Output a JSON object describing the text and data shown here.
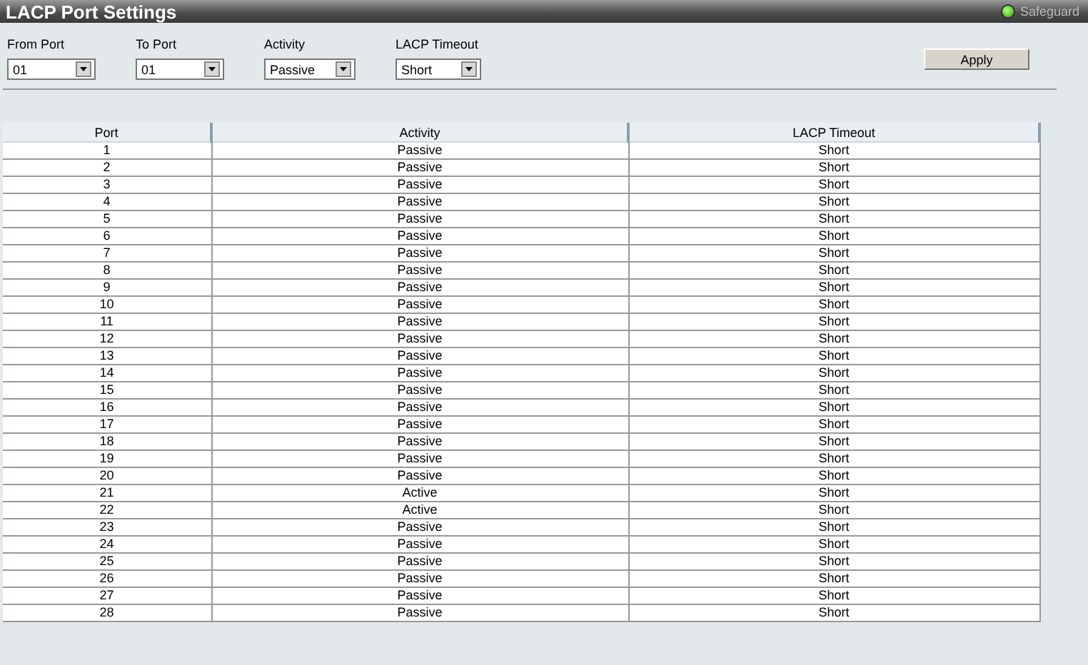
{
  "window": {
    "title": "LACP Port Settings",
    "status": {
      "label": "Safeguard",
      "on": true
    }
  },
  "form": {
    "fields": [
      {
        "label": "From Port",
        "value": "01"
      },
      {
        "label": "To Port",
        "value": "01"
      },
      {
        "label": "Activity",
        "value": "Passive"
      },
      {
        "label": "LACP Timeout",
        "value": "Short"
      }
    ],
    "apply": "Apply"
  },
  "table": {
    "columns": [
      "Port",
      "Activity",
      "LACP Timeout"
    ],
    "rows": [
      [
        "1",
        "Passive",
        "Short"
      ],
      [
        "2",
        "Passive",
        "Short"
      ],
      [
        "3",
        "Passive",
        "Short"
      ],
      [
        "4",
        "Passive",
        "Short"
      ],
      [
        "5",
        "Passive",
        "Short"
      ],
      [
        "6",
        "Passive",
        "Short"
      ],
      [
        "7",
        "Passive",
        "Short"
      ],
      [
        "8",
        "Passive",
        "Short"
      ],
      [
        "9",
        "Passive",
        "Short"
      ],
      [
        "10",
        "Passive",
        "Short"
      ],
      [
        "11",
        "Passive",
        "Short"
      ],
      [
        "12",
        "Passive",
        "Short"
      ],
      [
        "13",
        "Passive",
        "Short"
      ],
      [
        "14",
        "Passive",
        "Short"
      ],
      [
        "15",
        "Passive",
        "Short"
      ],
      [
        "16",
        "Passive",
        "Short"
      ],
      [
        "17",
        "Passive",
        "Short"
      ],
      [
        "18",
        "Passive",
        "Short"
      ],
      [
        "19",
        "Passive",
        "Short"
      ],
      [
        "20",
        "Passive",
        "Short"
      ],
      [
        "21",
        "Active",
        "Short"
      ],
      [
        "22",
        "Active",
        "Short"
      ],
      [
        "23",
        "Passive",
        "Short"
      ],
      [
        "24",
        "Passive",
        "Short"
      ],
      [
        "25",
        "Passive",
        "Short"
      ],
      [
        "26",
        "Passive",
        "Short"
      ],
      [
        "27",
        "Passive",
        "Short"
      ],
      [
        "28",
        "Passive",
        "Short"
      ]
    ]
  }
}
